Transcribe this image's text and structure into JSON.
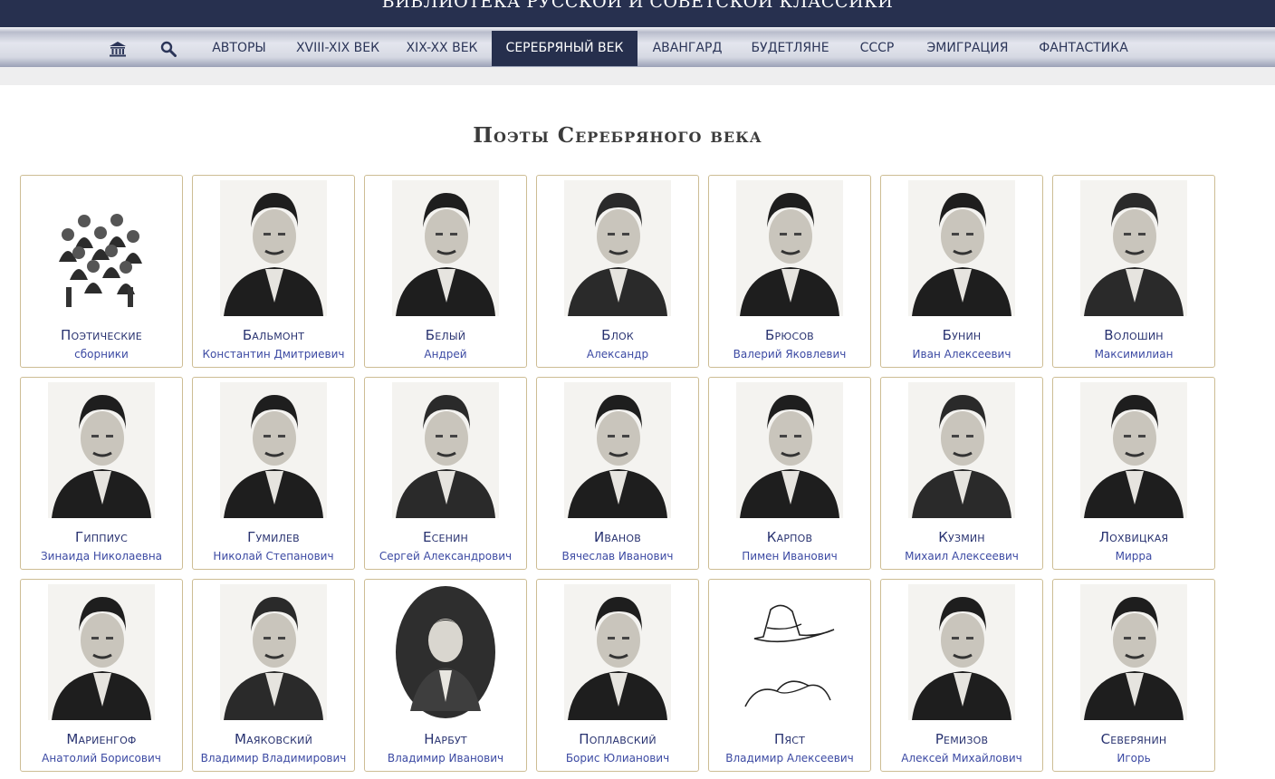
{
  "site": {
    "title": "БИБЛИОТЕКА РУССКОЙ И СОВЕТСКОЙ КЛАССИКИ"
  },
  "nav": {
    "icons": [
      {
        "name": "home-icon"
      },
      {
        "name": "search-icon"
      }
    ],
    "items": [
      {
        "label": "АВТОРЫ"
      },
      {
        "label": "XVIII-XIX ВЕК"
      },
      {
        "label": "XIX-XX ВЕК"
      },
      {
        "label": "СЕРЕБРЯНЫЙ ВЕК",
        "active": true
      },
      {
        "label": "АВАНГАРД"
      },
      {
        "label": "БУДЕТЛЯНЕ"
      },
      {
        "label": "СССР"
      },
      {
        "label": "ЭМИГРАЦИЯ"
      },
      {
        "label": "ФАНТАСТИКА"
      }
    ]
  },
  "page": {
    "heading": "Поэты Серебряного века"
  },
  "authors": [
    {
      "name": "Поэтические",
      "sub": "сборники",
      "portrait": "group-photo-icon"
    },
    {
      "name": "Бальмонт",
      "sub": "Константин Дмитриевич",
      "portrait": "portrait-icon"
    },
    {
      "name": "Белый",
      "sub": "Андрей",
      "portrait": "portrait-icon"
    },
    {
      "name": "Блок",
      "sub": "Александр",
      "portrait": "portrait-icon"
    },
    {
      "name": "Брюсов",
      "sub": "Валерий Яковлевич",
      "portrait": "portrait-icon"
    },
    {
      "name": "Бунин",
      "sub": "Иван Алексеевич",
      "portrait": "portrait-icon"
    },
    {
      "name": "Волошин",
      "sub": "Максимилиан",
      "portrait": "portrait-icon"
    },
    {
      "name": "Гиппиус",
      "sub": "Зинаида Николаевна",
      "portrait": "portrait-icon"
    },
    {
      "name": "Гумилев",
      "sub": "Николай Степанович",
      "portrait": "portrait-icon"
    },
    {
      "name": "Есенин",
      "sub": "Сергей Александрович",
      "portrait": "portrait-icon"
    },
    {
      "name": "Иванов",
      "sub": "Вячеслав Иванович",
      "portrait": "portrait-icon"
    },
    {
      "name": "Карпов",
      "sub": "Пимен Иванович",
      "portrait": "portrait-icon"
    },
    {
      "name": "Кузмин",
      "sub": "Михаил Алексеевич",
      "portrait": "portrait-icon"
    },
    {
      "name": "Лохвицкая",
      "sub": "Мирра",
      "portrait": "portrait-icon"
    },
    {
      "name": "Мариенгоф",
      "sub": "Анатолий Борисович",
      "portrait": "portrait-icon"
    },
    {
      "name": "Маяковский",
      "sub": "Владимир Владимирович",
      "portrait": "portrait-icon"
    },
    {
      "name": "Нарбут",
      "sub": "Владимир Иванович",
      "portrait": "oval-portrait-icon"
    },
    {
      "name": "Поплавский",
      "sub": "Борис Юлианович",
      "portrait": "portrait-icon"
    },
    {
      "name": "Пяст",
      "sub": "Владимир Алексеевич",
      "portrait": "hat-sketch-icon"
    },
    {
      "name": "Ремизов",
      "sub": "Алексей Михайлович",
      "portrait": "portrait-icon"
    },
    {
      "name": "Северянин",
      "sub": "Игорь",
      "portrait": "portrait-icon"
    }
  ],
  "colors": {
    "topbar": "#27304f",
    "nav_active": "#262f4d",
    "card_border": "#cdbd94",
    "name_text": "#283270",
    "sub_text": "#3c4aa3"
  }
}
